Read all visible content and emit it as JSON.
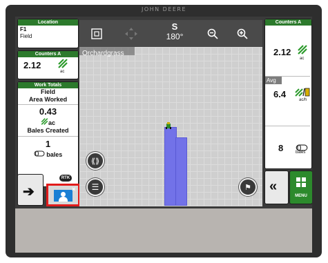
{
  "brand": "JOHN DEERE",
  "left": {
    "location": {
      "header": "Location",
      "line1": "F1",
      "line2": "Field"
    },
    "counters": {
      "header": "Counters A",
      "value": "2.12",
      "unit": "ac"
    },
    "work_totals": {
      "header": "Work Totals",
      "scope": "Field",
      "label1": "Area Worked",
      "value1": "0.43",
      "unit1": "ac",
      "label2": "Bales Created",
      "value2": "1",
      "unit2": "bales"
    },
    "rtk_badge": "RTK"
  },
  "map": {
    "field_label": "Orchardgrass",
    "heading_letter": "S",
    "heading_degrees": "180°"
  },
  "right": {
    "header": "Counters A",
    "area_value": "2.12",
    "area_unit": "ac",
    "avg_label": "Avg",
    "rate_value": "6.4",
    "rate_unit": "ac/h",
    "bales_value": "8",
    "bales_unit": "bales",
    "menu_label": "MENU"
  }
}
